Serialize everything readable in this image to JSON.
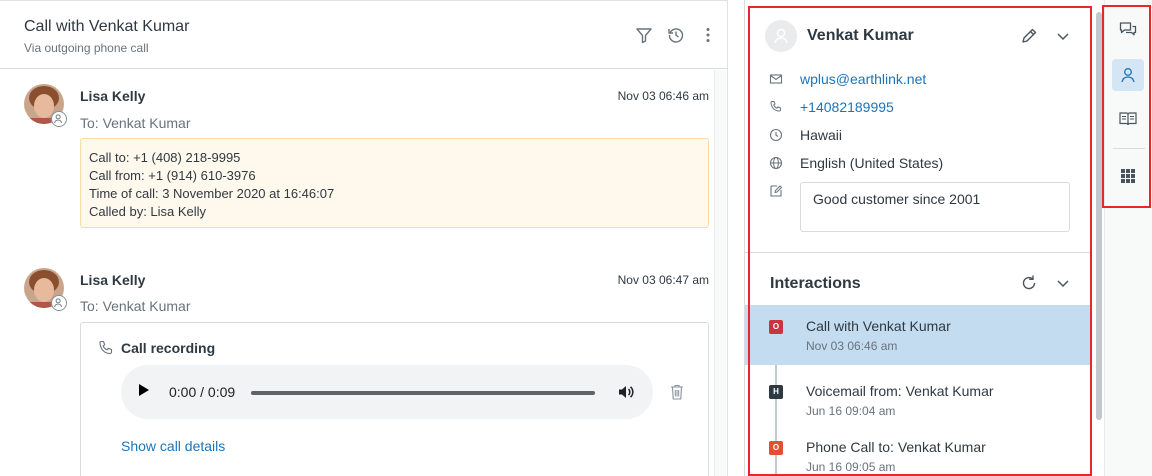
{
  "ticket": {
    "title": "Call with Venkat Kumar",
    "subtitle": "Via outgoing phone call",
    "header_icons": [
      "filter-icon",
      "history-icon",
      "more-vertical-icon"
    ]
  },
  "messages": [
    {
      "sender": "Lisa Kelly",
      "time": "Nov 03 06:46 am",
      "to": "To: Venkat Kumar",
      "lines": [
        "Call to: +1 (408) 218-9995",
        "Call from: +1 (914) 610-3976",
        "Time of call: 3 November 2020 at 16:46:07",
        "Called by: Lisa Kelly"
      ]
    },
    {
      "sender": "Lisa Kelly",
      "time": "Nov 03 06:47 am",
      "to": "To: Venkat Kumar",
      "recording": {
        "title": "Call recording",
        "player_time": "0:00 / 0:09",
        "show_details": "Show call details"
      }
    }
  ],
  "user": {
    "name": "Venkat Kumar",
    "email": "wplus@earthlink.net",
    "phone": "+14082189995",
    "timezone": "Hawaii",
    "language": "English (United States)",
    "notes": "Good customer since 2001"
  },
  "interactions": {
    "title": "Interactions",
    "items": [
      {
        "badge": "O",
        "badge_color": "#cc3340",
        "label": "Call with Venkat Kumar",
        "time": "Nov 03 06:46 am",
        "selected": true
      },
      {
        "badge": "H",
        "badge_color": "#2f3941",
        "label": "Voicemail from: Venkat Kumar",
        "time": "Jun 16 09:04 am",
        "selected": false
      },
      {
        "badge": "O",
        "badge_color": "#e34f32",
        "label": "Phone Call to: Venkat Kumar",
        "time": "Jun 16 09:05 am",
        "selected": false
      }
    ]
  },
  "rail": {
    "items": [
      "conversations-icon",
      "user-icon",
      "knowledge-icon",
      "apps-icon"
    ],
    "active": "user-icon"
  },
  "colors": {
    "link": "#1f73b7",
    "highlight_frame": "#e8262c",
    "selected_row": "#c4dcf0",
    "call_box_bg": "#fff8ed"
  }
}
